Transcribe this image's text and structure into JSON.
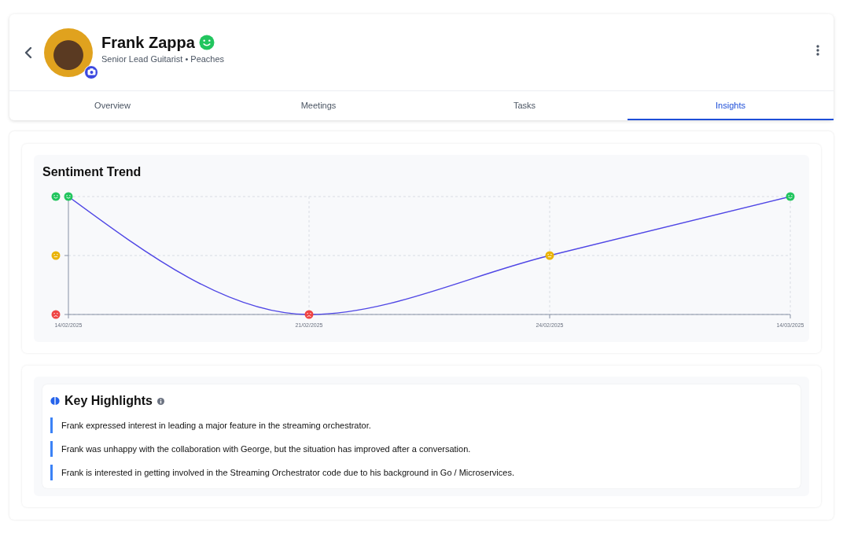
{
  "profile": {
    "name": "Frank Zappa",
    "happy": true,
    "subtitle": "Senior Lead Guitarist • Peaches"
  },
  "tabs": [
    {
      "label": "Overview",
      "selected": false
    },
    {
      "label": "Meetings",
      "selected": false
    },
    {
      "label": "Tasks",
      "selected": false
    },
    {
      "label": "Insights",
      "selected": true
    }
  ],
  "sentiment_trend": {
    "title": "Sentiment Trend",
    "points": [
      {
        "date": "14/02/2025",
        "kind": "happy"
      },
      {
        "date": "21/02/2025",
        "kind": "sad"
      },
      {
        "date": "24/02/2025",
        "kind": "neutral"
      },
      {
        "date": "14/03/2025",
        "kind": "happy"
      }
    ]
  },
  "key_highlights": {
    "title": "Key Highlights",
    "items": [
      "Frank expressed interest in leading a major feature in the streaming orchestrator.",
      "Frank was unhappy with the collaboration with George, but the situation has improved after a conversation.",
      "Frank is interested in getting involved in the Streaming Orchestrator code due to his background in Go / Microservices."
    ]
  }
}
